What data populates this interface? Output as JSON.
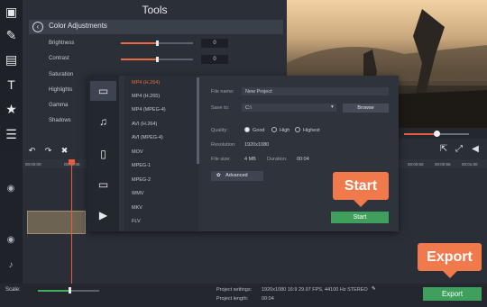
{
  "tools_panel": {
    "title": "Tools",
    "section_title": "Color Adjustments",
    "adjustments": [
      {
        "label": "Brightness",
        "value": "0",
        "level": 0.5
      },
      {
        "label": "Contrast",
        "value": "0",
        "level": 0.5
      },
      {
        "label": "Saturation"
      },
      {
        "label": "Highlights"
      },
      {
        "label": "Gamma"
      },
      {
        "label": "Shadows"
      }
    ]
  },
  "timeline": {
    "ticks": [
      "00:00:00",
      "00:00:05",
      "00:00:50",
      "00:00:55",
      "00:01:00"
    ]
  },
  "export_dialog": {
    "formats": [
      "MP4 (H.264)",
      "MP4 (H.265)",
      "MP4 (MPEG-4)",
      "AVI (H.264)",
      "AVI (MPEG-4)",
      "MOV",
      "MPEG-1",
      "MPEG-2",
      "WMV",
      "MKV",
      "FLV"
    ],
    "selected_format": "MP4 (H.264)",
    "file_name_label": "File name:",
    "file_name": "New Project",
    "save_to_label": "Save to:",
    "save_to": "C:\\",
    "browse_label": "Browse",
    "quality_label": "Quality:",
    "quality_options": [
      "Good",
      "High",
      "Highest"
    ],
    "quality_selected": "Good",
    "resolution_label": "Resolution:",
    "resolution": "1920x1080",
    "file_size_label": "File size:",
    "file_size": "4 MB",
    "duration_label": "Duration:",
    "duration": "00:04",
    "advanced_label": "Advanced",
    "start_label": "Start"
  },
  "callouts": {
    "start": "Start",
    "export": "Export"
  },
  "status_bar": {
    "scale_label": "Scale:",
    "scale_level": 0.5,
    "project_settings_label": "Project settings:",
    "project_settings": "1920x1080 16:9 29.97 FPS, 44100 Hz STEREO",
    "project_length_label": "Project length:",
    "project_length": "00:04",
    "export_label": "Export"
  },
  "playback": {
    "progress": 0.5
  },
  "colors": {
    "accent": "#e96a3e",
    "green": "#3f9f5c",
    "callout": "#f07a4c"
  },
  "icons": [
    "film-icon",
    "magic-wand-icon",
    "filmstrip-icon",
    "text-icon",
    "star-icon",
    "menu-icon",
    "undo-icon",
    "redo-icon",
    "trash-icon",
    "music-icon",
    "export-icon",
    "fullscreen-icon",
    "volume-icon",
    "eye-icon",
    "gear-icon"
  ]
}
